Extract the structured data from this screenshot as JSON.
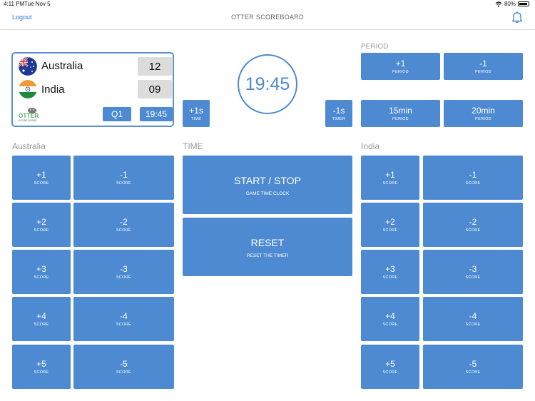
{
  "status_bar": {
    "time": "4:11 PM",
    "date": "Tue Nov 5",
    "battery": "80%"
  },
  "nav": {
    "logout": "Logout",
    "title": "OTTER SCOREBOARD"
  },
  "scoreboard": {
    "home": {
      "name": "Australia",
      "score": "12"
    },
    "away": {
      "name": "India",
      "score": "09"
    },
    "logo_text": "OTTER",
    "logo_subtext": "SCORE BOARD",
    "period": "Q1",
    "time": "19:45"
  },
  "clock": "19:45",
  "time_adjust": {
    "plus": {
      "label": "+1s",
      "sub": "TIME"
    },
    "minus": {
      "label": "-1s",
      "sub": "TIMER"
    }
  },
  "period_section": {
    "label": "PERIOD",
    "buttons": [
      {
        "label": "+1",
        "sub": "PERIOD"
      },
      {
        "label": "-1",
        "sub": "PERIOD"
      },
      {
        "label": "15min",
        "sub": "PERIOD"
      },
      {
        "label": "20min",
        "sub": "PERIOD"
      }
    ]
  },
  "home_controls": {
    "label": "Australia",
    "plus": [
      {
        "label": "+1",
        "sub": "SCORE"
      },
      {
        "label": "+2",
        "sub": "SCORE"
      },
      {
        "label": "+3",
        "sub": "SCORE"
      },
      {
        "label": "+4",
        "sub": "SCORE"
      },
      {
        "label": "+5",
        "sub": "SCORE"
      }
    ],
    "minus": [
      {
        "label": "-1",
        "sub": "SCORE"
      },
      {
        "label": "-2",
        "sub": "SCORE"
      },
      {
        "label": "-3",
        "sub": "SCORE"
      },
      {
        "label": "-4",
        "sub": "SCORE"
      },
      {
        "label": "-5",
        "sub": "SCORE"
      }
    ]
  },
  "away_controls": {
    "label": "India",
    "plus": [
      {
        "label": "+1",
        "sub": "SCORE"
      },
      {
        "label": "+2",
        "sub": "SCORE"
      },
      {
        "label": "+3",
        "sub": "SCORE"
      },
      {
        "label": "+4",
        "sub": "SCORE"
      },
      {
        "label": "+5",
        "sub": "SCORE"
      }
    ],
    "minus": [
      {
        "label": "-1",
        "sub": "SCORE"
      },
      {
        "label": "-2",
        "sub": "SCORE"
      },
      {
        "label": "-3",
        "sub": "SCORE"
      },
      {
        "label": "-4",
        "sub": "SCORE"
      },
      {
        "label": "-5",
        "sub": "SCORE"
      }
    ]
  },
  "time_section": {
    "label": "TIME",
    "start_stop": {
      "label": "START / STOP",
      "sub": "GAME TIME CLOCK"
    },
    "reset": {
      "label": "RESET",
      "sub": "RESET THE TIMER"
    }
  },
  "colors": {
    "accent": "#4d8ad1",
    "link": "#2e7ad1",
    "score_bg": "#dcdcdc"
  }
}
